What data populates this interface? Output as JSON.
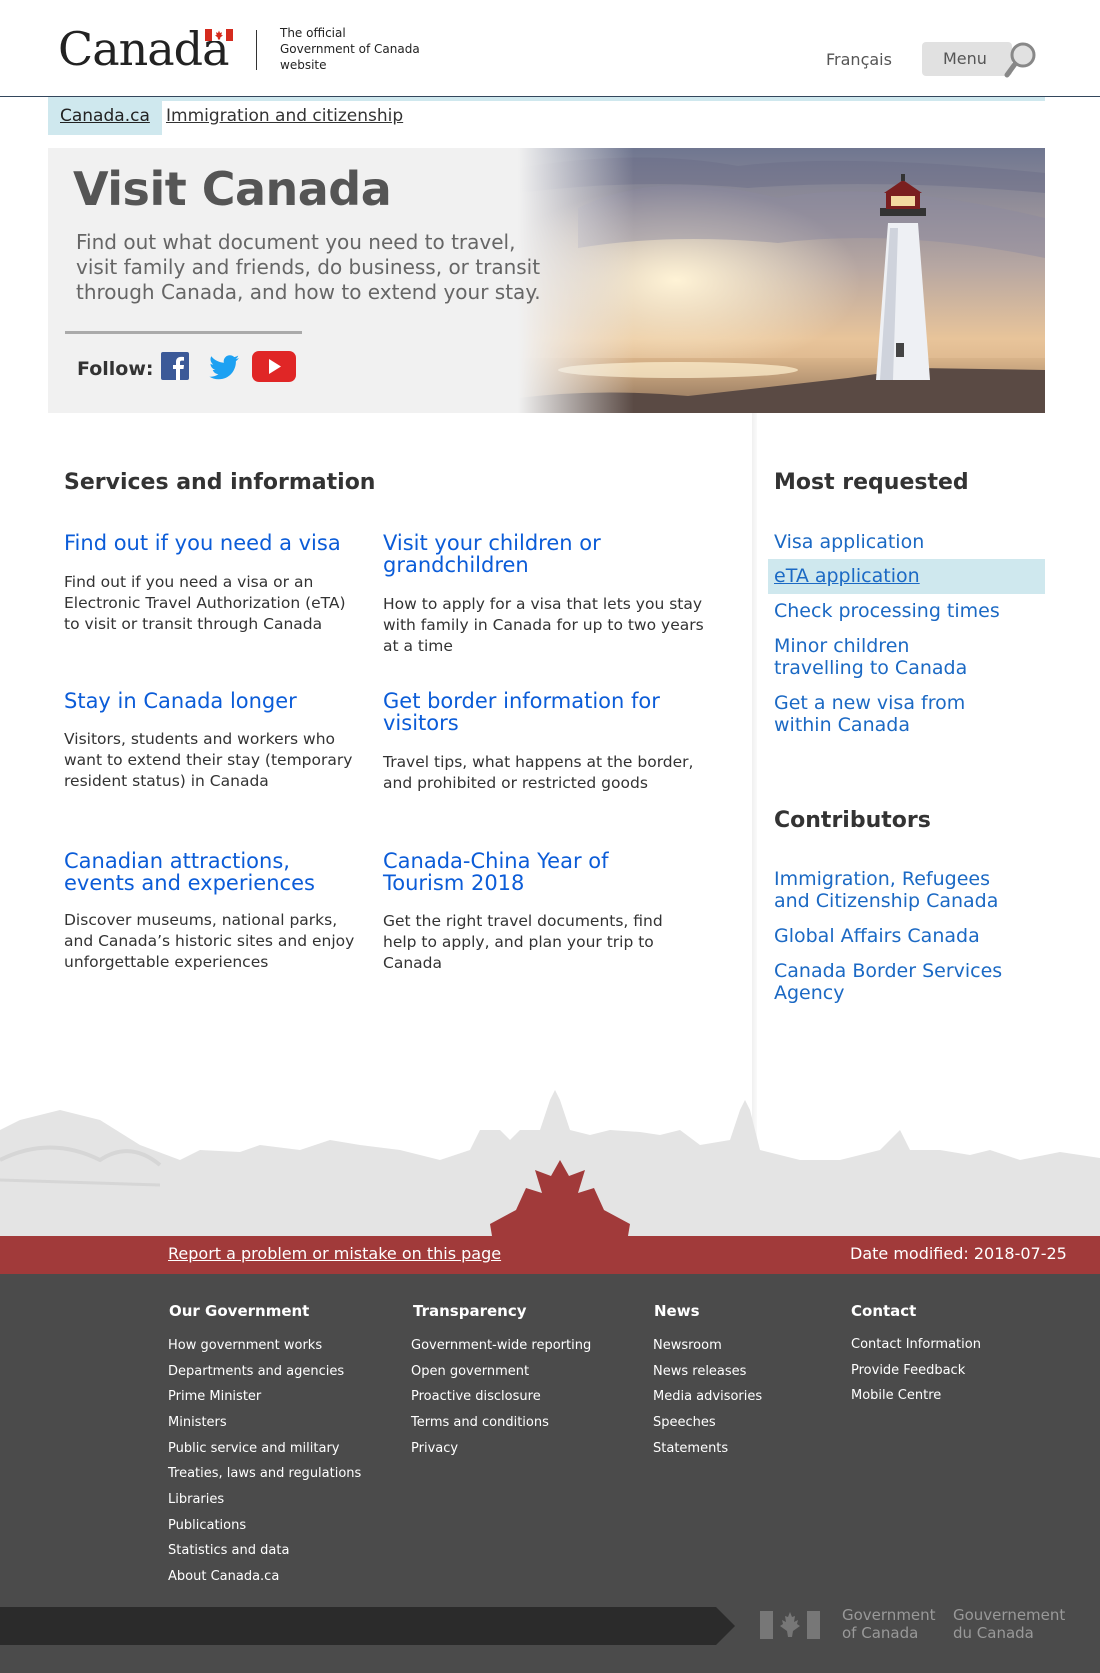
{
  "header": {
    "wordmark": "Canada",
    "official_lines": [
      "The official",
      "Government of Canada",
      "website"
    ],
    "language": "Français",
    "menu": "Menu"
  },
  "breadcrumb": [
    "Canada.ca",
    "Immigration and citizenship"
  ],
  "hero": {
    "title": "Visit Canada",
    "lead": "Find out what document you need to travel, visit family and friends, do business, or transit through Canada, and how to extend your stay.",
    "follow": "Follow:",
    "social_icons": [
      "facebook-icon",
      "twitter-icon",
      "youtube-icon"
    ]
  },
  "services": {
    "heading": "Services and information",
    "items": [
      {
        "title": "Find out if you need a visa",
        "desc": "Find out if you need a visa or an Electronic Travel Authorization (eTA) to visit or transit through Canada"
      },
      {
        "title": "Visit your children or grandchildren",
        "desc": "How to apply for a visa that lets you stay with family in Canada for up to two years at a time"
      },
      {
        "title": "Stay in Canada longer",
        "desc": "Visitors, students and workers who want to extend their stay (temporary resident status) in Canada"
      },
      {
        "title": "Get border information for visitors",
        "desc": "Travel tips, what happens at the border, and prohibited or restricted goods"
      },
      {
        "title": "Canadian attractions, events and experiences",
        "desc": "Discover museums, national parks, and Canada’s historic sites and enjoy unforgettable experiences"
      },
      {
        "title": "Canada-China Year of Tourism 2018",
        "desc": "Get the right travel documents, find help to apply, and plan your trip to Canada"
      }
    ]
  },
  "most_requested": {
    "heading": "Most requested",
    "links": [
      "Visa application",
      "eTA application",
      "Check processing times",
      "Minor children travelling to Canada",
      "Get a new visa from within Canada"
    ]
  },
  "contributors": {
    "heading": "Contributors",
    "links": [
      "Immigration, Refugees and Citizenship Canada",
      "Global Affairs Canada",
      "Canada Border Services Agency"
    ]
  },
  "footer": {
    "report": "Report a problem or mistake on this page",
    "date_modified": "Date modified: 2018-07-25",
    "columns": [
      {
        "heading": "Our Government",
        "links": [
          "How government works",
          "Departments and agencies",
          "Prime Minister",
          "Ministers",
          "Public service and military",
          "Treaties, laws and regulations",
          "Libraries",
          "Publications",
          "Statistics and data",
          "About Canada.ca"
        ]
      },
      {
        "heading": "Transparency",
        "links": [
          "Government-wide reporting",
          "Open government",
          "Proactive disclosure",
          "Terms and conditions",
          "Privacy"
        ]
      },
      {
        "heading": "News",
        "links": [
          "Newsroom",
          "News releases",
          "Media advisories",
          "Speeches",
          "Statements"
        ]
      },
      {
        "heading": "Contact",
        "links": [
          "Contact Information",
          "Provide Feedback",
          "Mobile Centre"
        ]
      }
    ],
    "gov_en": [
      "Government",
      "of Canada"
    ],
    "gov_fr": [
      "Gouvernement",
      "du Canada"
    ]
  },
  "colors": {
    "link": "#0b5cd8",
    "report_bar": "#a13a3a",
    "footer_bg": "#4b4b4b",
    "highlight": "#cfe8ee"
  }
}
